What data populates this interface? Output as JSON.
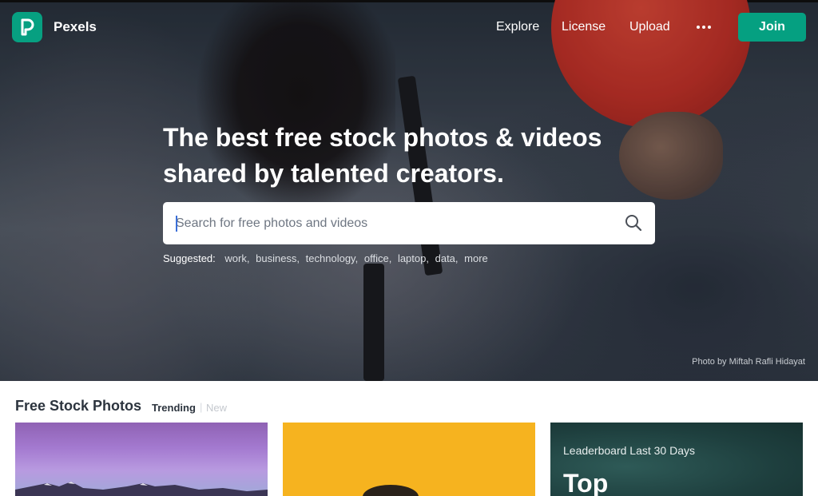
{
  "brand": {
    "name": "Pexels"
  },
  "nav": {
    "explore": "Explore",
    "license": "License",
    "upload": "Upload",
    "join": "Join"
  },
  "hero": {
    "headline_line1": "The best free stock photos & videos",
    "headline_line2": "shared by talented creators.",
    "credit": "Photo by Miftah Rafli Hidayat"
  },
  "search": {
    "placeholder": "Search for free photos and videos",
    "value": ""
  },
  "suggested": {
    "label": "Suggested:",
    "items": [
      "work",
      "business",
      "technology",
      "office",
      "laptop",
      "data",
      "more"
    ]
  },
  "section": {
    "title": "Free Stock Photos",
    "tab_trending": "Trending",
    "tab_divider": "|",
    "tab_new": "New"
  },
  "cards": {
    "leaderboard_label": "Leaderboard Last 30 Days",
    "leaderboard_title": "Top"
  },
  "colors": {
    "brand_green": "#05a081",
    "text_dark": "#2c343e"
  }
}
